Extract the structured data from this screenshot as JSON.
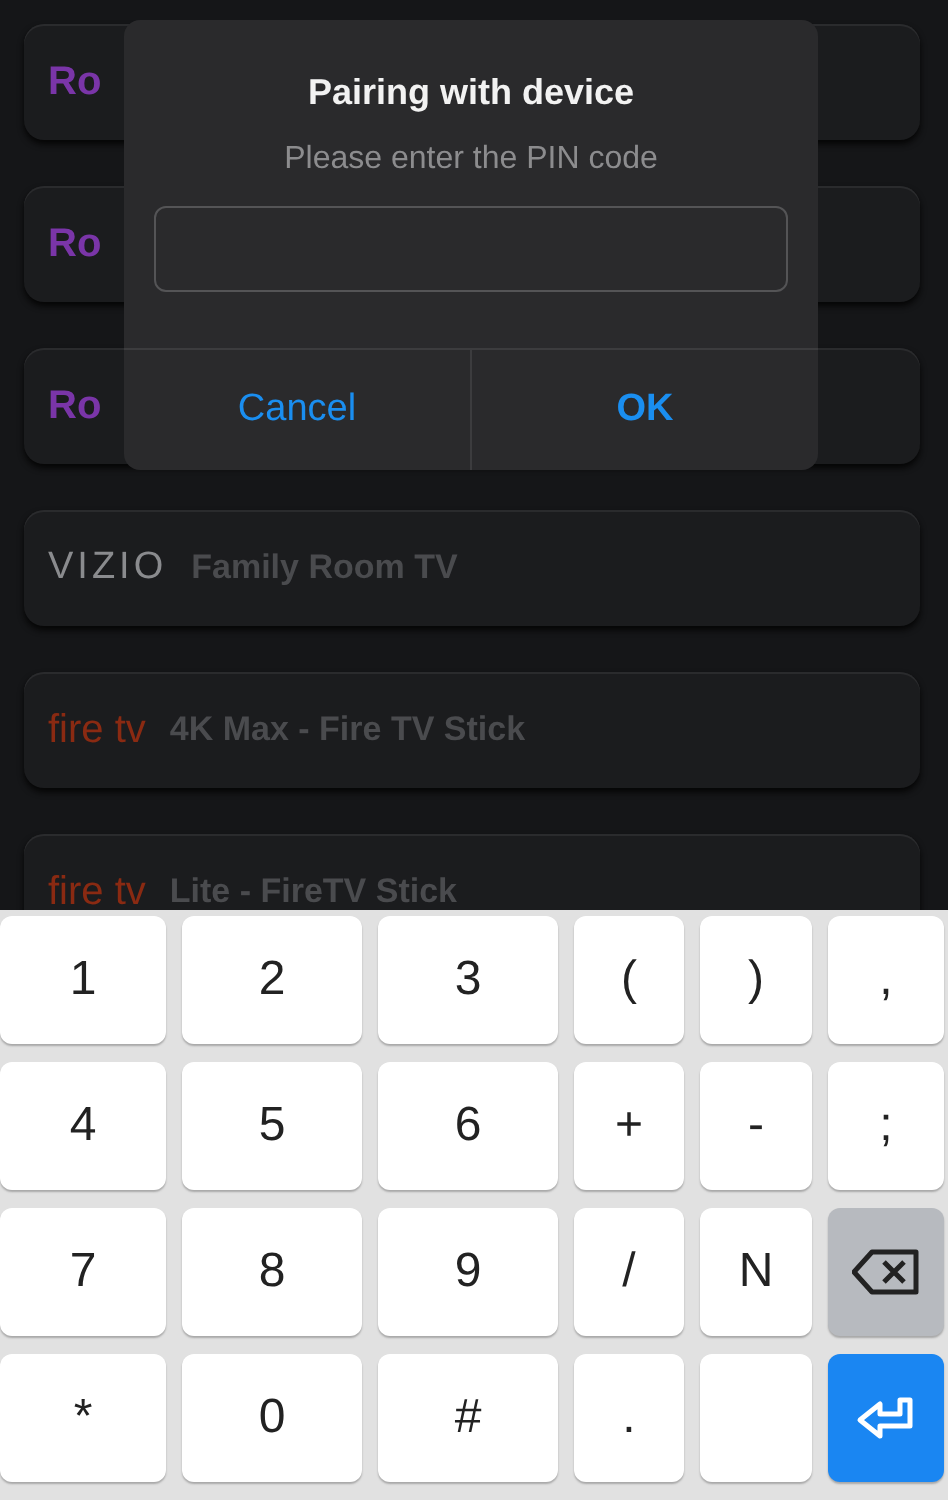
{
  "devices": [
    {
      "kind": "roku",
      "logo": "Ro"
    },
    {
      "kind": "roku",
      "logo": "Ro"
    },
    {
      "kind": "roku",
      "logo": "Ro"
    },
    {
      "kind": "vizio",
      "logo": "VIZIO",
      "name": "Family Room TV"
    },
    {
      "kind": "firetv",
      "logo": "fire tv",
      "name": "4K Max - Fire TV Stick"
    },
    {
      "kind": "firetv",
      "logo": "fire tv",
      "name": "Lite - FireTV Stick"
    }
  ],
  "dialog": {
    "title": "Pairing with device",
    "message": "Please enter the PIN code",
    "buttons": [
      {
        "label": "Cancel",
        "primary": false
      },
      {
        "label": "OK",
        "primary": true
      }
    ]
  },
  "keyboard": {
    "rows": [
      [
        {
          "kind": "char",
          "label": "1"
        },
        {
          "kind": "char",
          "label": "2"
        },
        {
          "kind": "char",
          "label": "3"
        },
        {
          "kind": "char",
          "label": "("
        },
        {
          "kind": "char",
          "label": ")"
        },
        {
          "kind": "char",
          "label": ","
        }
      ],
      [
        {
          "kind": "char",
          "label": "4"
        },
        {
          "kind": "char",
          "label": "5"
        },
        {
          "kind": "char",
          "label": "6"
        },
        {
          "kind": "char",
          "label": "+"
        },
        {
          "kind": "char",
          "label": "-"
        },
        {
          "kind": "char",
          "label": ";"
        }
      ],
      [
        {
          "kind": "char",
          "label": "7"
        },
        {
          "kind": "char",
          "label": "8"
        },
        {
          "kind": "char",
          "label": "9"
        },
        {
          "kind": "char",
          "label": "/"
        },
        {
          "kind": "char",
          "label": "N"
        },
        {
          "kind": "backspace"
        }
      ],
      [
        {
          "kind": "char",
          "label": "*"
        },
        {
          "kind": "char",
          "label": "0"
        },
        {
          "kind": "char",
          "label": "#"
        },
        {
          "kind": "char",
          "label": "."
        },
        {
          "kind": "blank"
        },
        {
          "kind": "enter"
        }
      ]
    ]
  }
}
